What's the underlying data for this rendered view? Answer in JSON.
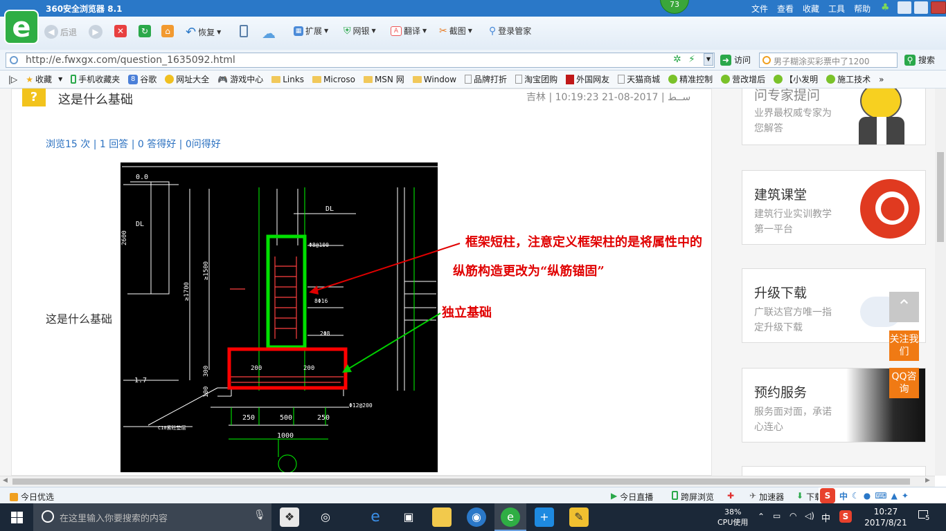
{
  "browser": {
    "title": "360安全浏览器 8.1",
    "badge": "73",
    "menu": [
      "文件",
      "查看",
      "收藏",
      "工具",
      "帮助"
    ],
    "toolbar": {
      "back_label": "后退",
      "restore_label": "恢复",
      "extend_label": "扩展",
      "bank_label": "网银",
      "translate_label": "翻译",
      "screenshot_label": "截图",
      "login_label": "登录管家"
    },
    "url": "http://e.fwxgx.com/question_1635092.html",
    "visit_label": "访问",
    "search_placeholder": "男子糊涂买彩票中了1200",
    "search_button": "搜索",
    "bookmarks": [
      "收藏",
      "手机收藏夹",
      "谷歌",
      "网址大全",
      "游戏中心",
      "Links",
      "Microso",
      "MSN 网",
      "Window",
      "品牌打折",
      "淘宝团购",
      "外国网友",
      "天猫商城",
      "精准控制",
      "营改增后",
      "【小发明",
      "施工技术"
    ]
  },
  "question": {
    "icon": "?",
    "title": "这是什么基础",
    "meta": "吉林 | ســط | 2017-08-21 10:19:23",
    "stats": "浏览15 次 | 1 回答 | 0 答得好 | 0问得好",
    "body": "这是什么基础"
  },
  "drawing": {
    "annotation_column_line1": "框架短柱，注意定义框架柱的是将属性中的",
    "annotation_column_line2": "纵筋构造更改为“纵筋锚固”",
    "annotation_foundation": "独立基础",
    "labels": {
      "elev_top": "0.0",
      "elev_bottom": "-1.7",
      "dl_left": "DL",
      "dl_right": "DL",
      "dim_2600": "2600",
      "dim_1700": "≥1700",
      "dim_1500": "≥1500",
      "dim_300": "300",
      "dim_100": "100",
      "rebar_top": "Φ8@100",
      "rebar_mid": "8Φ16",
      "rebar_lower": "2Φ8",
      "rebar_base": "Φ12@200",
      "footing_left": "200",
      "footing_right": "200",
      "dim_250_left": "250",
      "dim_500": "500",
      "dim_250_right": "250",
      "dim_1000": "1000",
      "note_bottom": "C10素砼垫层"
    }
  },
  "sidebar": [
    {
      "title": "问专家提问",
      "subtitle": "业界最权威专家为您解答"
    },
    {
      "title": "建筑课堂",
      "subtitle": "建筑行业实训教学第一平台"
    },
    {
      "title": "升级下载",
      "subtitle": "广联达官方唯一指定升级下载"
    },
    {
      "title": "预约服务",
      "subtitle": "服务面对面，承诺心连心"
    }
  ],
  "float_buttons": {
    "follow": "关注我们",
    "qq": "QQ咨询"
  },
  "statusbar": {
    "left": "今日优选",
    "live": "今日直播",
    "cross": "跨屏浏览",
    "accel": "加速器",
    "download": "下载",
    "ime": "中"
  },
  "taskbar": {
    "search_placeholder": "在这里输入你要搜索的内容",
    "cpu_percent": "38%",
    "cpu_label": "CPU使用",
    "ime": "中",
    "time": "10:27",
    "date": "2017/8/21",
    "notifications": "5"
  },
  "colors": {
    "title_bar": "#2a78c8",
    "green_box": "#00e000",
    "red_box": "#ff0000",
    "accent_orange": "#f07a14"
  }
}
